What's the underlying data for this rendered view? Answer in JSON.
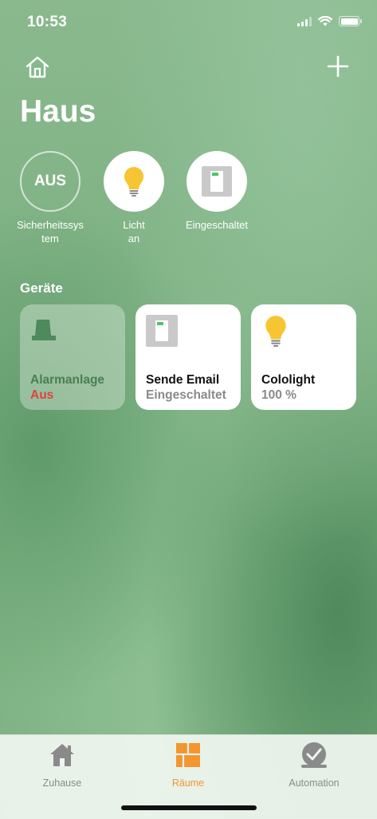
{
  "status_bar": {
    "time": "10:53"
  },
  "header": {
    "title": "Haus"
  },
  "quick_access": [
    {
      "circle_text": "AUS",
      "label_line1": "Sicherheitssys",
      "label_line2": "tem",
      "icon": "security-off"
    },
    {
      "label_line1": "Licht",
      "label_line2": "an",
      "icon": "lightbulb-icon"
    },
    {
      "label_line1": "Eingeschaltet",
      "label_line2": "",
      "icon": "switch-icon"
    }
  ],
  "devices_section": {
    "title": "Geräte"
  },
  "devices": [
    {
      "name": "Alarmanlage",
      "status": "Aus",
      "icon": "siren-icon",
      "status_color": "#e0453a"
    },
    {
      "name": "Sende Email",
      "status": "Eingeschaltet",
      "icon": "switch-icon"
    },
    {
      "name": "Cololight",
      "status": "100 %",
      "icon": "lightbulb-icon"
    }
  ],
  "tabs": [
    {
      "label": "Zuhause",
      "icon": "house-icon",
      "active": false
    },
    {
      "label": "Räume",
      "icon": "rooms-icon",
      "active": true
    },
    {
      "label": "Automation",
      "icon": "clock-icon",
      "active": false
    }
  ],
  "colors": {
    "accent": "#f4952e",
    "bulb": "#f7c531",
    "alarm_status": "#e0453a"
  }
}
